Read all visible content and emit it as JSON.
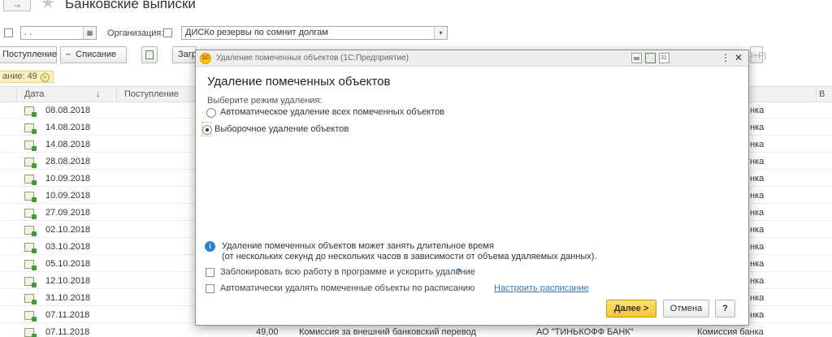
{
  "window": {
    "title": "Банковские выписки",
    "back_arrow": "→",
    "star": "★"
  },
  "filters": {
    "date_value": " . .",
    "org_label": "Организация:",
    "org_value": "ДИСКо резервы по сомнит долгам",
    "calendar_glyph": "▦",
    "dropdown_glyph": "▾"
  },
  "toolbar": {
    "receipt_label": "Поступление",
    "writeoff_label": "Списание",
    "writeoff_sign": "–",
    "load_label": "Загр",
    "search_hint": "l+F)"
  },
  "filter_tag": {
    "text": "ание: 49",
    "close": "✕"
  },
  "grid": {
    "columns": {
      "date": "Дата",
      "sort_arrow": "↓",
      "receipt": "Поступление",
      "last": "В"
    },
    "rows": [
      {
        "date": "08.08.2018",
        "tail": "нка"
      },
      {
        "date": "14.08.2018",
        "tail": "нка"
      },
      {
        "date": "14.08.2018",
        "tail": "нка"
      },
      {
        "date": "28.08.2018",
        "tail": "нка"
      },
      {
        "date": "10.09.2018",
        "tail": "нка"
      },
      {
        "date": "10.09.2018",
        "tail": "нка"
      },
      {
        "date": "27.09.2018",
        "tail": "нка"
      },
      {
        "date": "02.10.2018",
        "tail": "нка"
      },
      {
        "date": "03.10.2018",
        "tail": "нка"
      },
      {
        "date": "05.10.2018",
        "tail": "нка"
      },
      {
        "date": "12.10.2018",
        "tail": "нка"
      },
      {
        "date": "31.10.2018",
        "tail": "нка"
      },
      {
        "date": "07.11.2018",
        "tail": "нка"
      }
    ],
    "partial_row": {
      "date": "07.11.2018",
      "amount": "49,00",
      "purpose": "Комиссия за внешний банковский перевод",
      "counterparty": "АО \"ТИНЬКОФФ БАНК\"",
      "operation": "Комиссия банка"
    }
  },
  "dialog": {
    "logo_text": "1С",
    "window_title": "Удаление помеченных объектов (1С:Предприятие)",
    "heading": "Удаление помеченных объектов",
    "prompt": "Выберите режим удаления:",
    "modes": [
      {
        "label": "Автоматическое удаление всех помеченных объектов",
        "selected": false
      },
      {
        "label": "Выборочное удаление объектов",
        "selected": true
      }
    ],
    "info_glyph": "i",
    "info_line1": "Удаление помеченных объектов может занять длительное время",
    "info_line2": "(от нескольких секунд до нескольких часов в зависимости от объема удаляемых данных).",
    "lock_option": {
      "label": "Заблокировать всю работу в программе и ускорить удаление",
      "checked": false
    },
    "help_mark": "?",
    "schedule_option": {
      "label": "Автоматически удалять помеченные объекты по расписанию",
      "checked": false
    },
    "schedule_link": "Настроить расписание",
    "next_button": "Далее >",
    "cancel_button": "Отмена",
    "help_button": "?",
    "more_glyph": "⋮",
    "close_glyph": "✕"
  },
  "colors": {
    "primary_button": "#f4c630",
    "link": "#3a76b8",
    "info_icon": "#2b7fd1",
    "filter_tag_bg": "#fbf1bd"
  }
}
